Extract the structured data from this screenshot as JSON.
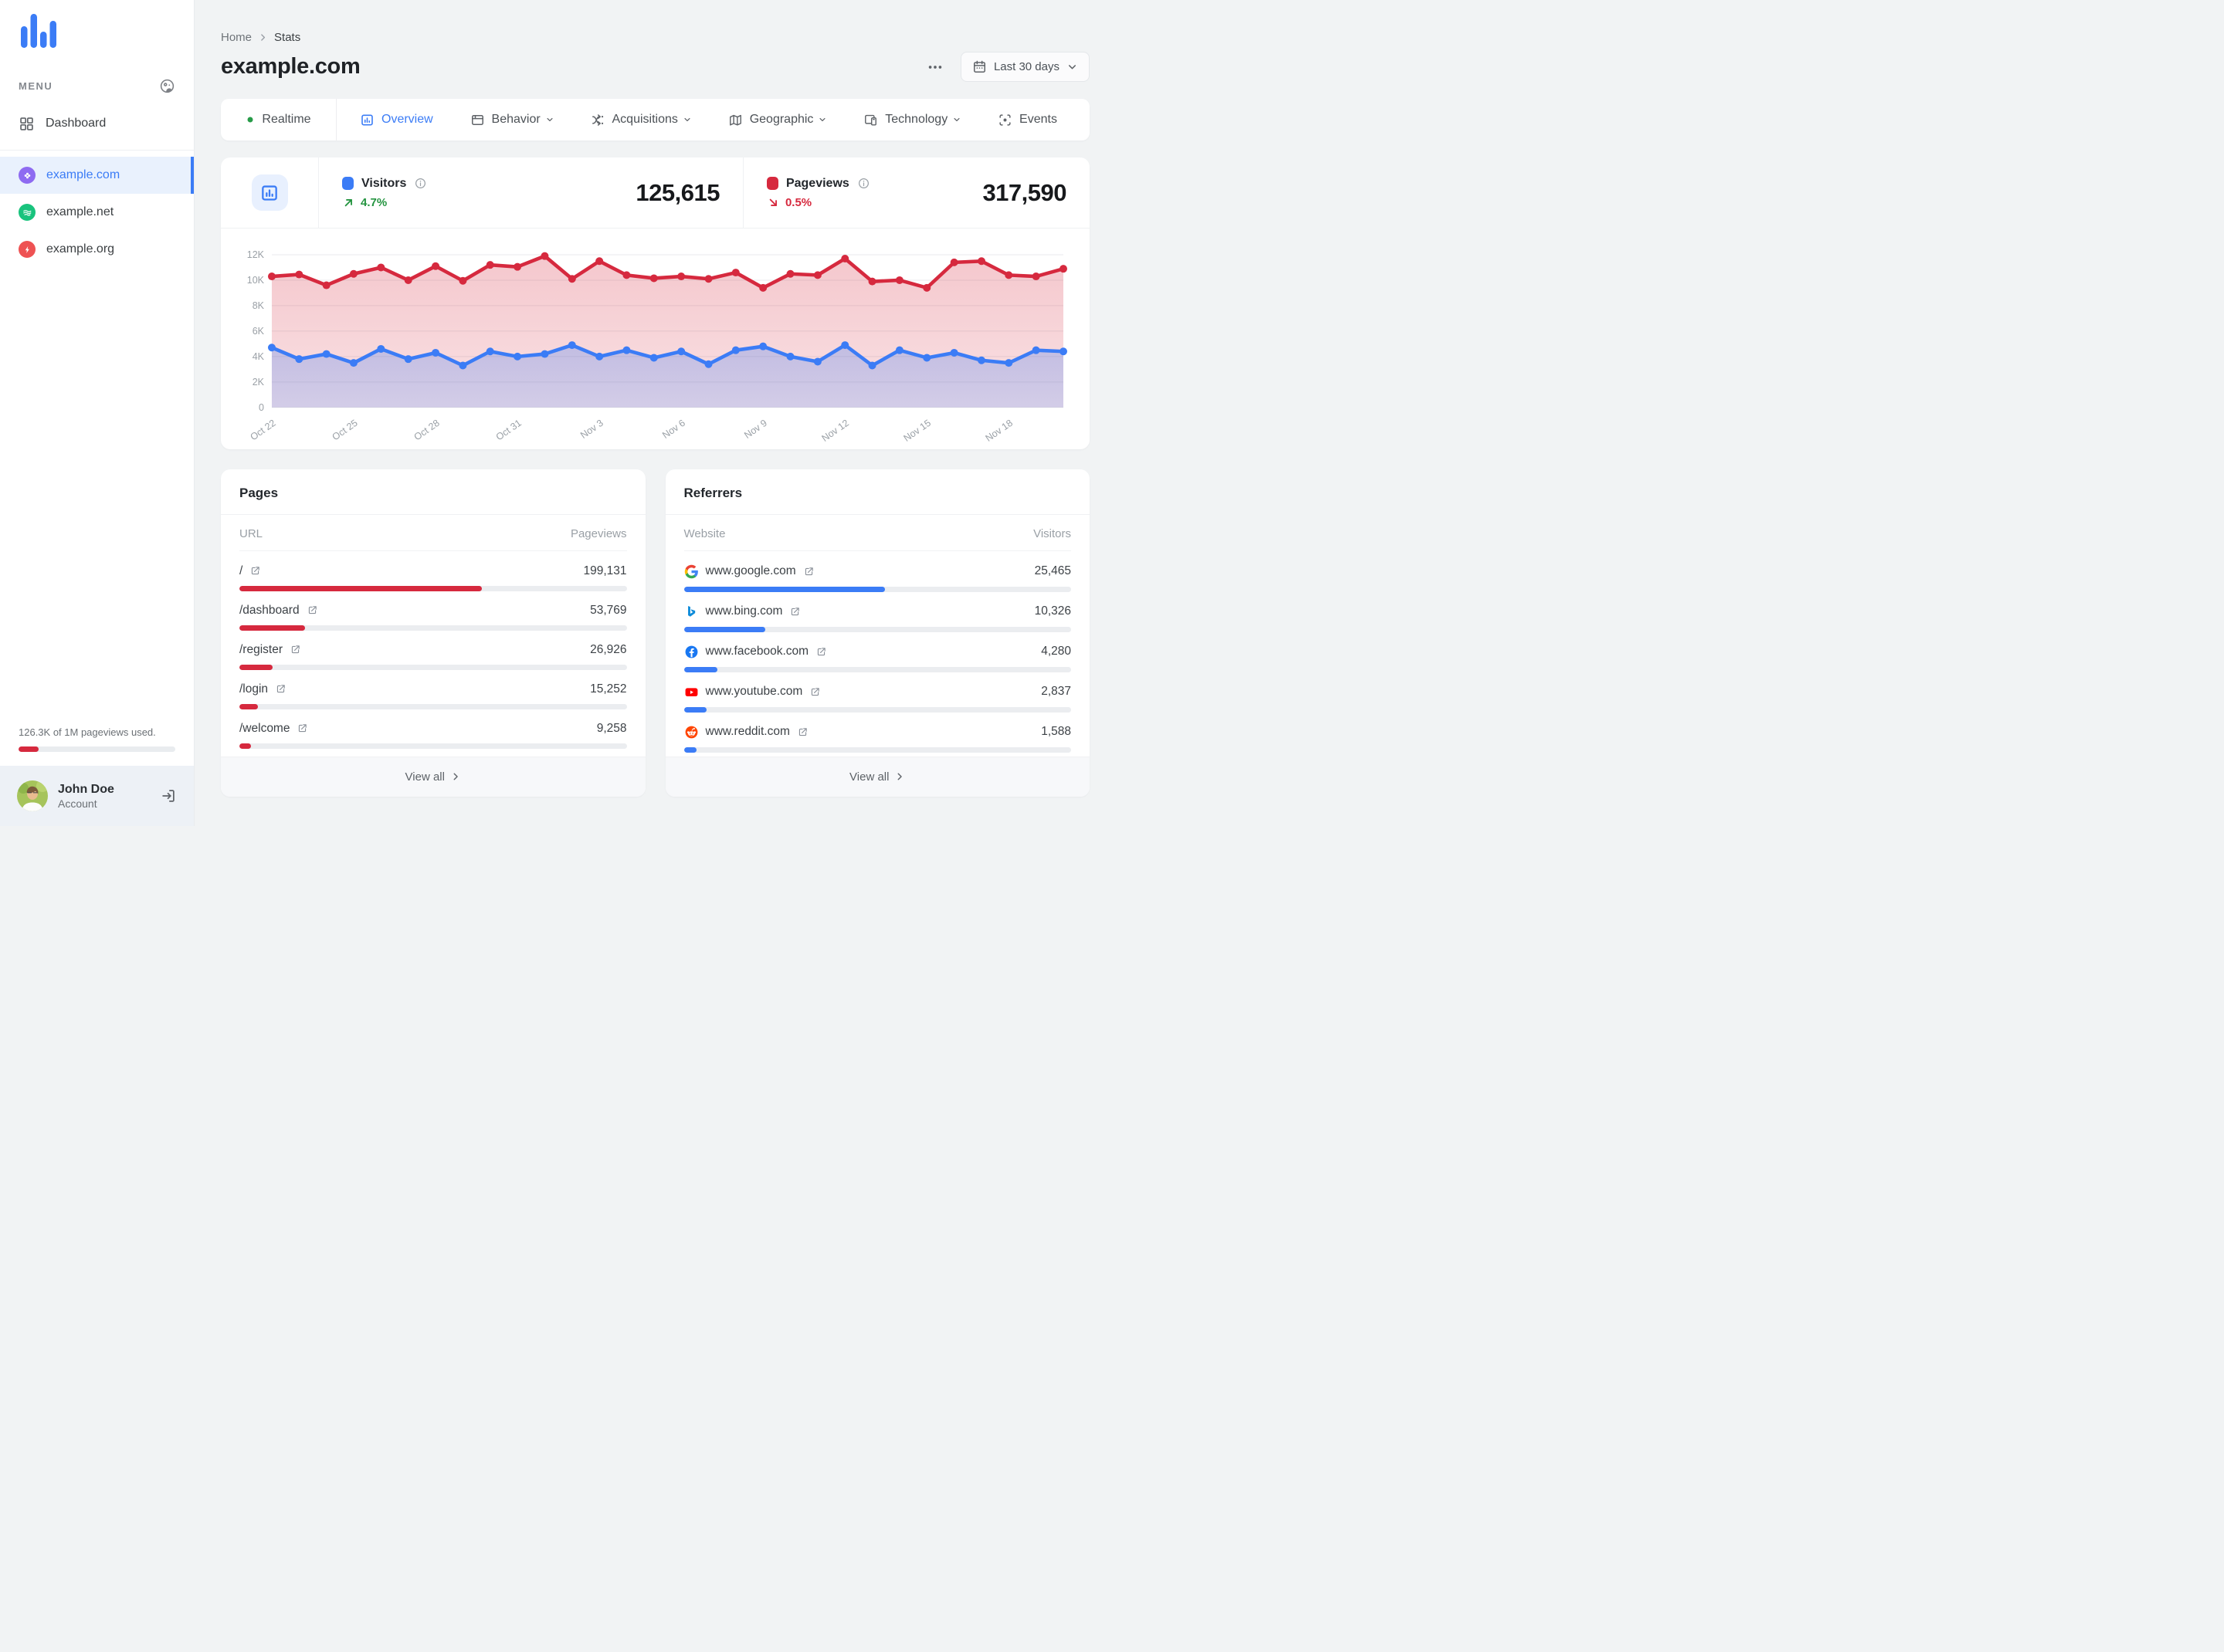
{
  "colors": {
    "accent_blue": "#3b7cf6",
    "accent_red": "#d6293e",
    "accent_green": "#249440"
  },
  "sidebar": {
    "menu_label": "MENU",
    "items": [
      {
        "label": "Dashboard",
        "icon": "grid"
      }
    ],
    "sites": [
      {
        "label": "example.com",
        "icon": "clover",
        "color": "#8e6bf1",
        "active": true
      },
      {
        "label": "example.net",
        "icon": "waves",
        "color": "#19c37d",
        "active": false
      },
      {
        "label": "example.org",
        "icon": "bolt",
        "color": "#ee5253",
        "active": false
      }
    ],
    "usage": {
      "text": "126.3K of 1M pageviews used.",
      "percent": 12.6
    },
    "account": {
      "name": "John Doe",
      "role": "Account"
    }
  },
  "header": {
    "breadcrumb": {
      "home": "Home",
      "current": "Stats"
    },
    "title": "example.com",
    "date_range": "Last 30 days"
  },
  "tabs": [
    {
      "label": "Realtime",
      "icon": "dot",
      "caret": false,
      "active": false
    },
    {
      "label": "Overview",
      "icon": "chart",
      "caret": false,
      "active": true
    },
    {
      "label": "Behavior",
      "icon": "browser",
      "caret": true,
      "active": false
    },
    {
      "label": "Acquisitions",
      "icon": "share",
      "caret": true,
      "active": false
    },
    {
      "label": "Geographic",
      "icon": "map",
      "caret": true,
      "active": false
    },
    {
      "label": "Technology",
      "icon": "devices",
      "caret": true,
      "active": false
    },
    {
      "label": "Events",
      "icon": "scan",
      "caret": false,
      "active": false
    }
  ],
  "stats": {
    "visitors": {
      "label": "Visitors",
      "value": "125,615",
      "change": "4.7%",
      "direction": "up",
      "color": "#3b7cf6"
    },
    "pageviews": {
      "label": "Pageviews",
      "value": "317,590",
      "change": "0.5%",
      "direction": "down",
      "color": "#d6293e"
    }
  },
  "chart_data": {
    "type": "area",
    "title": "Visitors and Pageviews over last 30 days",
    "x": [
      "Oct 22",
      "Oct 23",
      "Oct 24",
      "Oct 25",
      "Oct 26",
      "Oct 27",
      "Oct 28",
      "Oct 29",
      "Oct 30",
      "Oct 31",
      "Nov 1",
      "Nov 2",
      "Nov 3",
      "Nov 4",
      "Nov 5",
      "Nov 6",
      "Nov 7",
      "Nov 8",
      "Nov 9",
      "Nov 10",
      "Nov 11",
      "Nov 12",
      "Nov 13",
      "Nov 14",
      "Nov 15",
      "Nov 16",
      "Nov 17",
      "Nov 18",
      "Nov 19",
      "Nov 20"
    ],
    "x_tick_labels": [
      "Oct 22",
      "Oct 25",
      "Oct 28",
      "Oct 31",
      "Nov 3",
      "Nov 6",
      "Nov 9",
      "Nov 12",
      "Nov 15",
      "Nov 18"
    ],
    "x_tick_every": 3,
    "series": [
      {
        "name": "Pageviews",
        "color": "#d6293e",
        "values": [
          10300,
          10450,
          9600,
          10500,
          11000,
          10000,
          11100,
          9950,
          11200,
          11050,
          11900,
          10100,
          11500,
          10400,
          10150,
          10300,
          10100,
          10600,
          9400,
          10500,
          10400,
          11700,
          9900,
          10000,
          9400,
          11400,
          11500,
          10400,
          10300,
          10900
        ]
      },
      {
        "name": "Visitors",
        "color": "#3b7cf6",
        "values": [
          4700,
          3800,
          4200,
          3500,
          4600,
          3800,
          4300,
          3300,
          4400,
          4000,
          4200,
          4900,
          4000,
          4500,
          3900,
          4400,
          3400,
          4500,
          4800,
          4000,
          3600,
          4900,
          3300,
          4500,
          3900,
          4300,
          3700,
          3500,
          4500,
          4400
        ]
      }
    ],
    "ylim": [
      0,
      12000
    ],
    "y_ticks": [
      "0",
      "2K",
      "4K",
      "6K",
      "8K",
      "10K",
      "12K"
    ],
    "grid": "horizontal",
    "legend": "none"
  },
  "pages": {
    "title": "Pages",
    "col_name": "URL",
    "col_value": "Pageviews",
    "view_all": "View all",
    "bar_color": "#d6293e",
    "rows": [
      {
        "url": "/",
        "value": "199,131",
        "bar_percent": 62.7
      },
      {
        "url": "/dashboard",
        "value": "53,769",
        "bar_percent": 16.9
      },
      {
        "url": "/register",
        "value": "26,926",
        "bar_percent": 8.5
      },
      {
        "url": "/login",
        "value": "15,252",
        "bar_percent": 4.8
      },
      {
        "url": "/welcome",
        "value": "9,258",
        "bar_percent": 2.9
      }
    ]
  },
  "referrers": {
    "title": "Referrers",
    "col_name": "Website",
    "col_value": "Visitors",
    "view_all": "View all",
    "bar_color": "#3b7cf6",
    "rows": [
      {
        "website": "www.google.com",
        "icon": "google",
        "value": "25,465",
        "bar_percent": 52.0
      },
      {
        "website": "www.bing.com",
        "icon": "bing",
        "value": "10,326",
        "bar_percent": 21.1
      },
      {
        "website": "www.facebook.com",
        "icon": "facebook",
        "value": "4,280",
        "bar_percent": 8.7
      },
      {
        "website": "www.youtube.com",
        "icon": "youtube",
        "value": "2,837",
        "bar_percent": 5.8
      },
      {
        "website": "www.reddit.com",
        "icon": "reddit",
        "value": "1,588",
        "bar_percent": 3.2
      }
    ]
  }
}
